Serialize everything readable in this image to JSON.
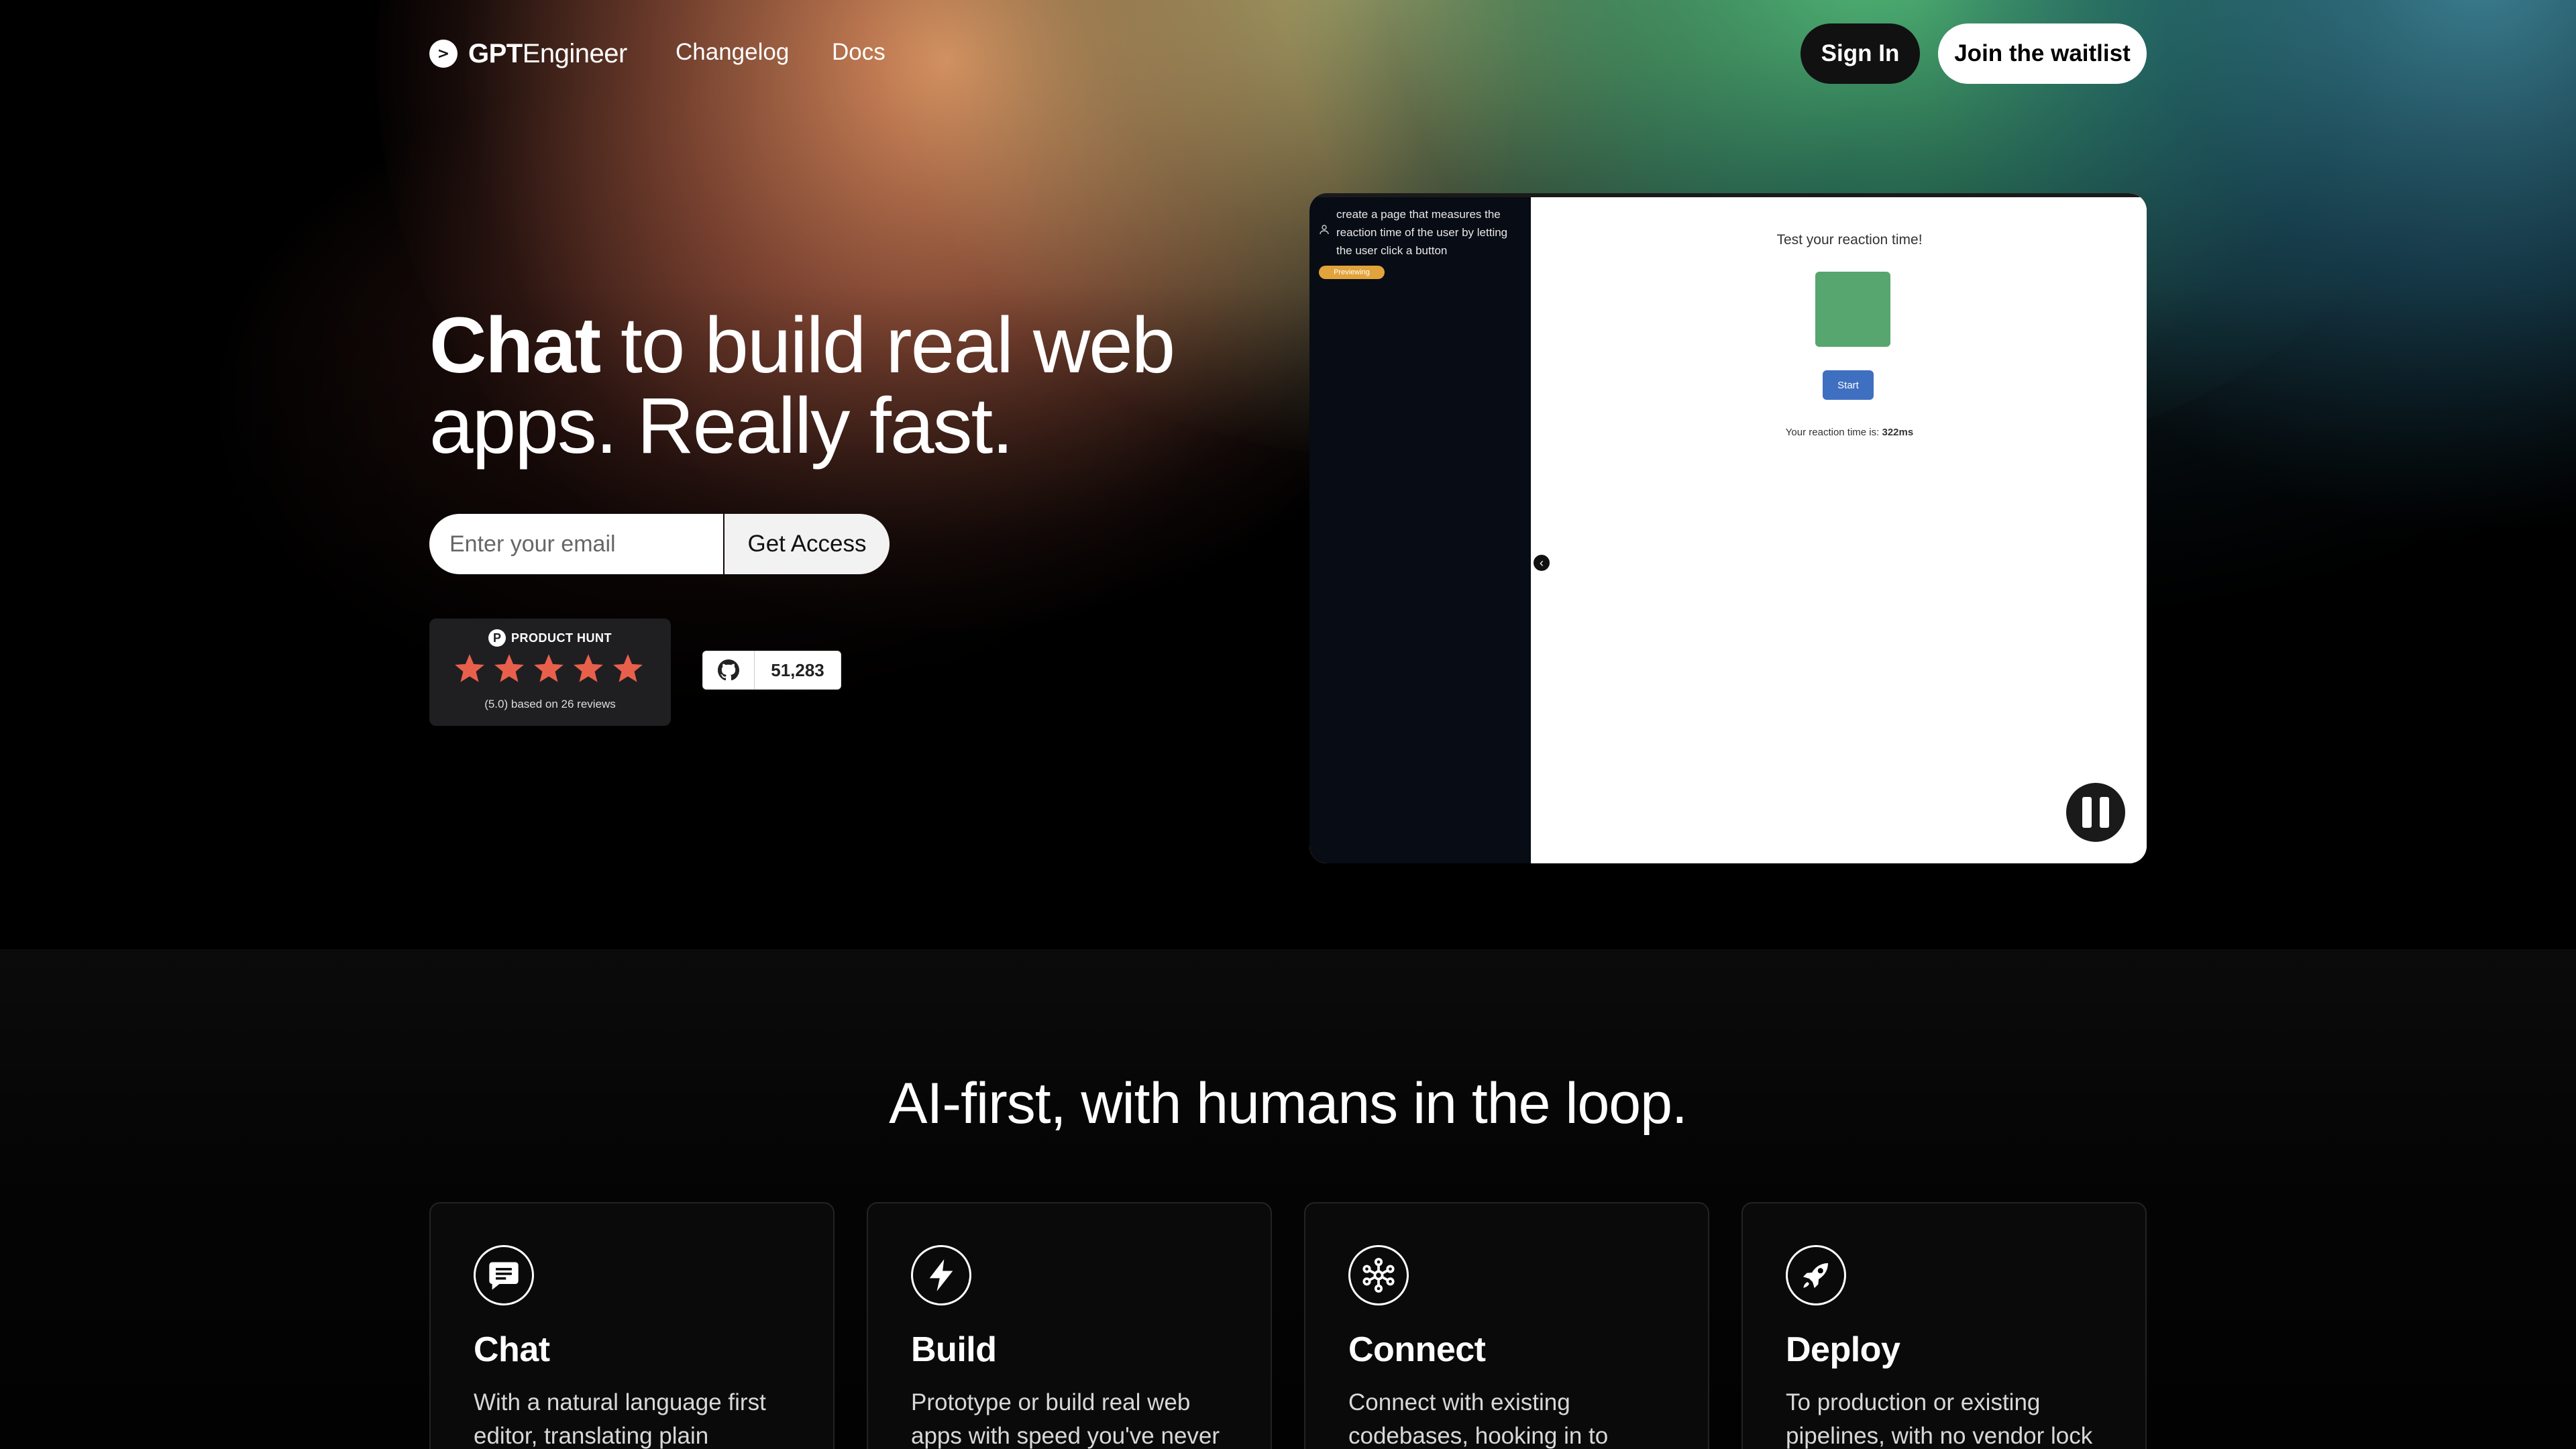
{
  "nav": {
    "logo_bold": "GPT",
    "logo_regular": "Engineer",
    "links": [
      "Changelog",
      "Docs"
    ],
    "sign_in": "Sign In",
    "join": "Join the waitlist"
  },
  "hero": {
    "headline_bold": "Chat",
    "headline_rest": " to build real web apps. Really fast.",
    "email_placeholder": "Enter your email",
    "cta": "Get Access"
  },
  "product_hunt": {
    "label": "PRODUCT HUNT",
    "rating": 5,
    "reviews_text": "(5.0) based on 26 reviews",
    "star_color": "#e8604c"
  },
  "github": {
    "stars": "51,283"
  },
  "demo": {
    "prompt": "create a page that measures the reaction time of the user by letting the user click a button",
    "chip": "Previewing",
    "title": "Test your reaction time!",
    "button": "Start",
    "result_prefix": "Your reaction time is: ",
    "result_value": "322ms",
    "square_color": "#57a56f",
    "button_color": "#3f6fc0"
  },
  "features": {
    "title": "AI-first, with humans in the loop.",
    "cards": [
      {
        "icon": "chat-bubble-icon",
        "title": "Chat",
        "desc": "With a natural language first editor, translating plain"
      },
      {
        "icon": "lightning-bolt-icon",
        "title": "Build",
        "desc": "Prototype or build real web apps with speed you've never"
      },
      {
        "icon": "network-nodes-icon",
        "title": "Connect",
        "desc": "Connect with existing codebases, hooking in to"
      },
      {
        "icon": "rocket-icon",
        "title": "Deploy",
        "desc": "To production or existing pipelines, with no vendor lock"
      }
    ]
  }
}
